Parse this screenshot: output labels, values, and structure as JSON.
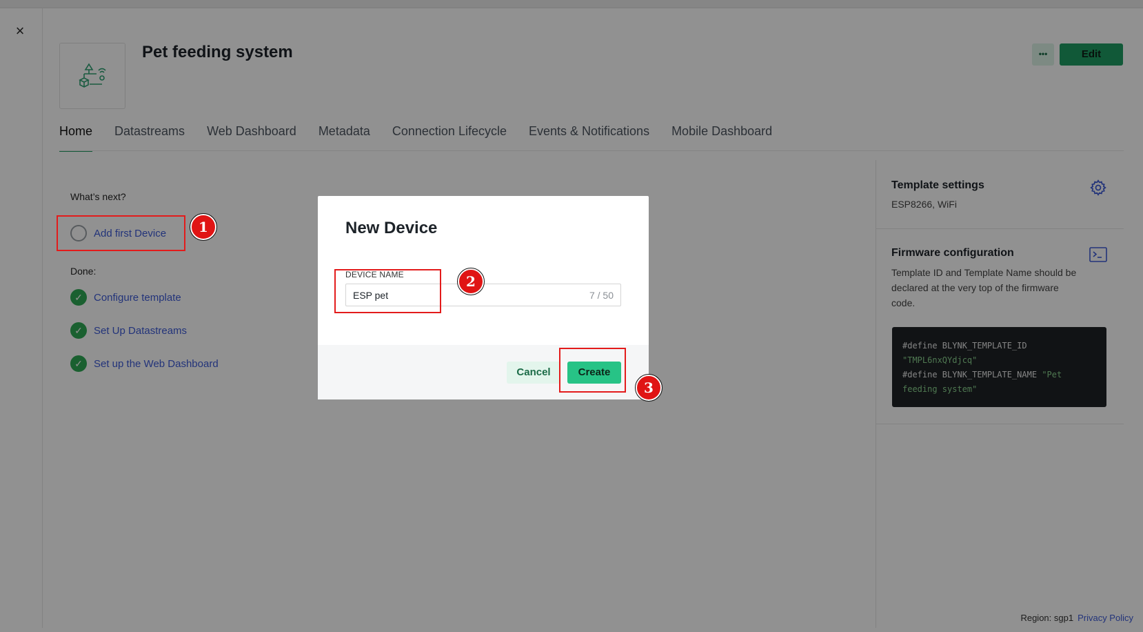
{
  "window": {
    "close_symbol": "×"
  },
  "header": {
    "title": "Pet feeding system",
    "more_label": "•••",
    "edit_label": "Edit"
  },
  "tabs": [
    {
      "label": "Home",
      "active": true
    },
    {
      "label": "Datastreams"
    },
    {
      "label": "Web Dashboard"
    },
    {
      "label": "Metadata"
    },
    {
      "label": "Connection Lifecycle"
    },
    {
      "label": "Events & Notifications"
    },
    {
      "label": "Mobile Dashboard"
    }
  ],
  "checklist": {
    "next_heading": "What’s next?",
    "next_items": [
      {
        "label": "Add first Device"
      }
    ],
    "done_heading": "Done:",
    "done_items": [
      {
        "label": "Configure template"
      },
      {
        "label": "Set Up Datastreams"
      },
      {
        "label": "Set up the Web Dashboard"
      }
    ]
  },
  "side": {
    "template_settings_title": "Template settings",
    "template_settings_sub": "ESP8266, WiFi",
    "firmware_title": "Firmware configuration",
    "firmware_desc": "Template ID and Template Name should be declared at the very top of the firmware code.",
    "code": {
      "line1_kw": "#define BLYNK_TEMPLATE_ID",
      "line2_str": "\"TMPL6nxQYdjcq\"",
      "line3_kw": "#define BLYNK_TEMPLATE_NAME",
      "line3_str": "\"Pet",
      "line4_str": "feeding system\""
    }
  },
  "modal": {
    "title": "New Device",
    "field_label": "DEVICE NAME",
    "field_value": "ESP pet",
    "field_count": "7 / 50",
    "cancel_label": "Cancel",
    "create_label": "Create"
  },
  "footer": {
    "region": "Region: sgp1",
    "privacy": "Privacy Policy"
  },
  "annotations": {
    "one": "1",
    "two": "2",
    "three": "3",
    "color": "#e31b1b"
  },
  "colors": {
    "accent": "#1e9d63",
    "link": "#3d5ad6",
    "create": "#27c386"
  }
}
